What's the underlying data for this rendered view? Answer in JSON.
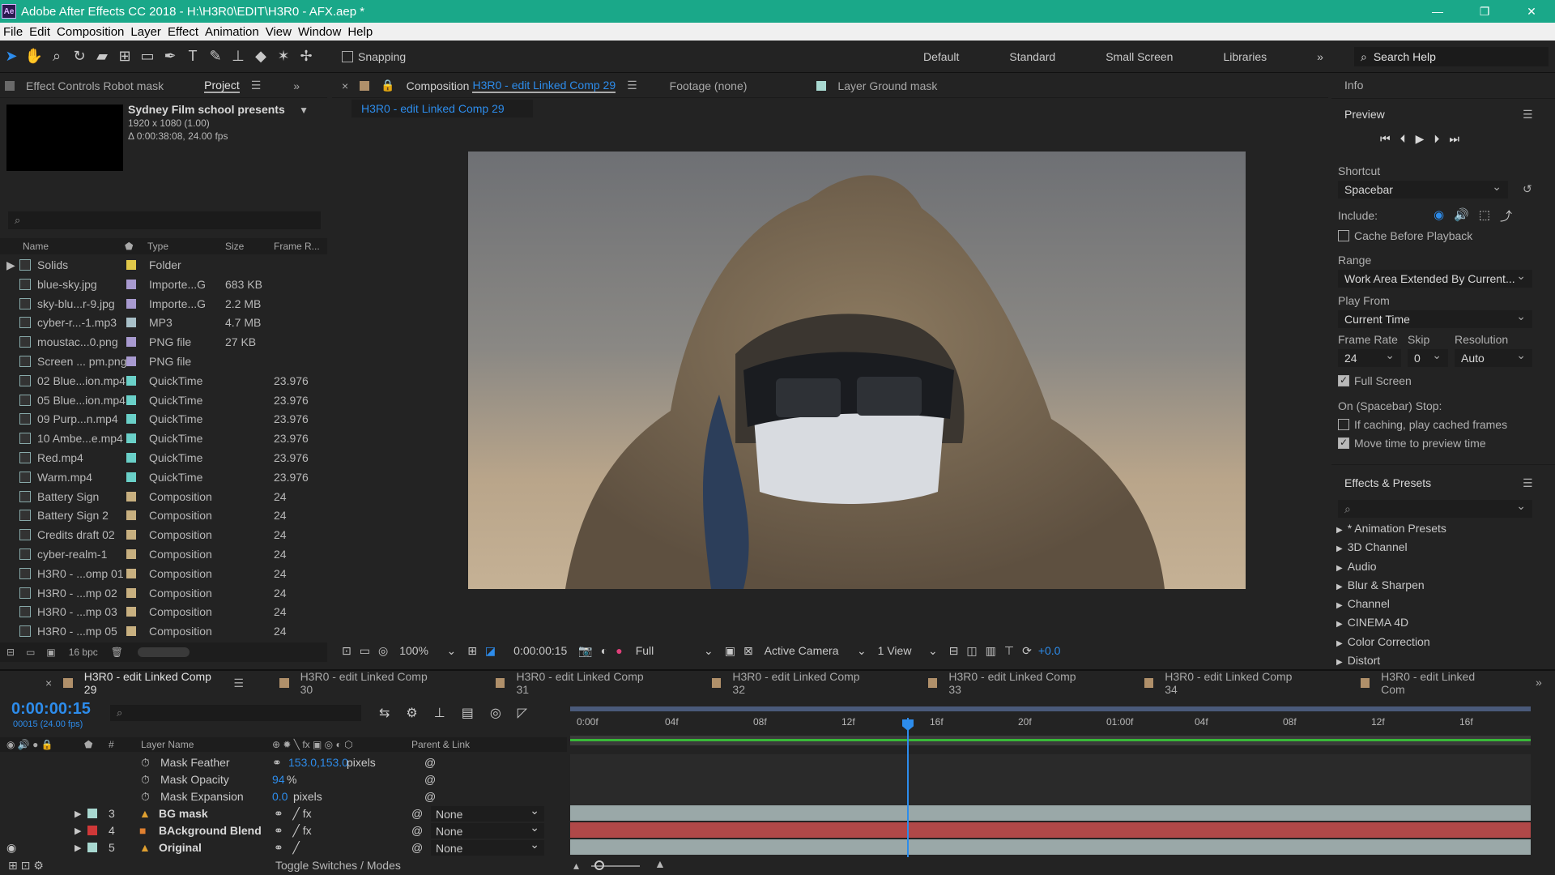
{
  "window": {
    "title": "Adobe After Effects CC 2018 - H:\\H3R0\\EDIT\\H3R0 - AFX.aep *",
    "app_badge": "Ae"
  },
  "menu": [
    "File",
    "Edit",
    "Composition",
    "Layer",
    "Effect",
    "Animation",
    "View",
    "Window",
    "Help"
  ],
  "toolbar": {
    "snapping_label": "Snapping",
    "workspaces": [
      "Default",
      "Standard",
      "Small Screen",
      "Libraries"
    ],
    "search_placeholder": "Search Help"
  },
  "project_panel": {
    "effect_controls_tab": "Effect Controls Robot mask",
    "project_tab": "Project",
    "selected_name": "Sydney Film school presents",
    "selected_res": "1920 x 1080 (1.00)",
    "selected_dur": "Δ 0:00:38:08, 24.00 fps",
    "columns": {
      "name": "Name",
      "type": "Type",
      "size": "Size",
      "frame": "Frame R..."
    },
    "items": [
      {
        "name": "Solids",
        "type": "Folder",
        "size": "",
        "frame": "",
        "color": "#e0c84a"
      },
      {
        "name": "blue-sky.jpg",
        "type": "Importe...G",
        "size": "683 KB",
        "frame": "",
        "color": "#a89ad0"
      },
      {
        "name": "sky-blu...r-9.jpg",
        "type": "Importe...G",
        "size": "2.2 MB",
        "frame": "",
        "color": "#a89ad0"
      },
      {
        "name": "cyber-r...-1.mp3",
        "type": "MP3",
        "size": "4.7 MB",
        "frame": "",
        "color": "#a8c0c8"
      },
      {
        "name": "moustac...0.png",
        "type": "PNG file",
        "size": "27 KB",
        "frame": "",
        "color": "#a89ad0"
      },
      {
        "name": "Screen ... pm.png",
        "type": "PNG file",
        "size": "",
        "frame": "",
        "color": "#a89ad0"
      },
      {
        "name": "02 Blue...ion.mp4",
        "type": "QuickTime",
        "size": "",
        "frame": "23.976",
        "color": "#6ad0c8"
      },
      {
        "name": "05 Blue...ion.mp4",
        "type": "QuickTime",
        "size": "",
        "frame": "23.976",
        "color": "#6ad0c8"
      },
      {
        "name": "09 Purp...n.mp4",
        "type": "QuickTime",
        "size": "",
        "frame": "23.976",
        "color": "#6ad0c8"
      },
      {
        "name": "10 Ambe...e.mp4",
        "type": "QuickTime",
        "size": "",
        "frame": "23.976",
        "color": "#6ad0c8"
      },
      {
        "name": "Red.mp4",
        "type": "QuickTime",
        "size": "",
        "frame": "23.976",
        "color": "#6ad0c8"
      },
      {
        "name": "Warm.mp4",
        "type": "QuickTime",
        "size": "",
        "frame": "23.976",
        "color": "#6ad0c8"
      },
      {
        "name": "Battery Sign",
        "type": "Composition",
        "size": "",
        "frame": "24",
        "color": "#c8b080"
      },
      {
        "name": "Battery Sign 2",
        "type": "Composition",
        "size": "",
        "frame": "24",
        "color": "#c8b080"
      },
      {
        "name": "Credits draft 02",
        "type": "Composition",
        "size": "",
        "frame": "24",
        "color": "#c8b080"
      },
      {
        "name": "cyber-realm-1",
        "type": "Composition",
        "size": "",
        "frame": "24",
        "color": "#c8b080"
      },
      {
        "name": "H3R0 - ...omp 01",
        "type": "Composition",
        "size": "",
        "frame": "24",
        "color": "#c8b080"
      },
      {
        "name": "H3R0 - ...mp 02",
        "type": "Composition",
        "size": "",
        "frame": "24",
        "color": "#c8b080"
      },
      {
        "name": "H3R0 - ...mp 03",
        "type": "Composition",
        "size": "",
        "frame": "24",
        "color": "#c8b080"
      },
      {
        "name": "H3R0 - ...mp 05",
        "type": "Composition",
        "size": "",
        "frame": "24",
        "color": "#c8b080"
      }
    ],
    "bpc": "16 bpc"
  },
  "comp_panel": {
    "tab_prefix": "Composition",
    "tab_name": "H3R0 - edit Linked Comp 29",
    "footage_tab": "Footage (none)",
    "layer_tab": "Layer Ground mask",
    "subtab": "H3R0 - edit Linked Comp 29",
    "zoom": "100%",
    "timecode": "0:00:00:15",
    "quality": "Full",
    "camera": "Active Camera",
    "views": "1 View",
    "exposure": "+0.0"
  },
  "right_panel": {
    "info": "Info",
    "preview": "Preview",
    "shortcut_label": "Shortcut",
    "shortcut_value": "Spacebar",
    "include_label": "Include:",
    "cache_label": "Cache Before Playback",
    "range_label": "Range",
    "range_value": "Work Area Extended By Current...",
    "playfrom_label": "Play From",
    "playfrom_value": "Current Time",
    "framerate_label": "Frame Rate",
    "skip_label": "Skip",
    "resolution_label": "Resolution",
    "framerate_value": "24",
    "skip_value": "0",
    "resolution_value": "Auto",
    "fullscreen_label": "Full Screen",
    "onstop_label": "On (Spacebar) Stop:",
    "ifcaching_label": "If caching, play cached frames",
    "movetime_label": "Move time to preview time",
    "effects_title": "Effects & Presets",
    "effects": [
      "* Animation Presets",
      "3D Channel",
      "Audio",
      "Blur & Sharpen",
      "Channel",
      "CINEMA 4D",
      "Color Correction",
      "Distort"
    ]
  },
  "timeline": {
    "tabs": [
      "H3R0 - edit Linked Comp 29",
      "H3R0 - edit Linked Comp 30",
      "H3R0 - edit Linked Comp 31",
      "H3R0 - edit Linked Comp 32",
      "H3R0 - edit Linked Comp 33",
      "H3R0 - edit Linked Comp 34",
      "H3R0 - edit Linked Com"
    ],
    "timecode": "0:00:00:15",
    "timecode_sub": "00015 (24.00 fps)",
    "col_hash": "#",
    "col_layer": "Layer Name",
    "col_parent": "Parent & Link",
    "ruler": [
      "0:00f",
      "04f",
      "08f",
      "12f",
      "16f",
      "20f",
      "01:00f",
      "04f",
      "08f",
      "12f",
      "16f"
    ],
    "props": [
      {
        "name": "Mask Feather",
        "value": "153.0,153.0",
        "unit": "pixels"
      },
      {
        "name": "Mask Opacity",
        "value": "94",
        "unit": "%"
      },
      {
        "name": "Mask Expansion",
        "value": "0.0",
        "unit": "pixels"
      }
    ],
    "layers": [
      {
        "num": "3",
        "name": "BG mask",
        "parent": "None",
        "color": "#a8d8d0",
        "bar": "#9aa8a8"
      },
      {
        "num": "4",
        "name": "BAckground Blend",
        "parent": "None",
        "color": "#d03838",
        "bar": "#b04848"
      },
      {
        "num": "5",
        "name": "Original",
        "parent": "None",
        "color": "#a8d8d0",
        "bar": "#9aa8a8"
      }
    ],
    "toggle_label": "Toggle Switches / Modes"
  }
}
